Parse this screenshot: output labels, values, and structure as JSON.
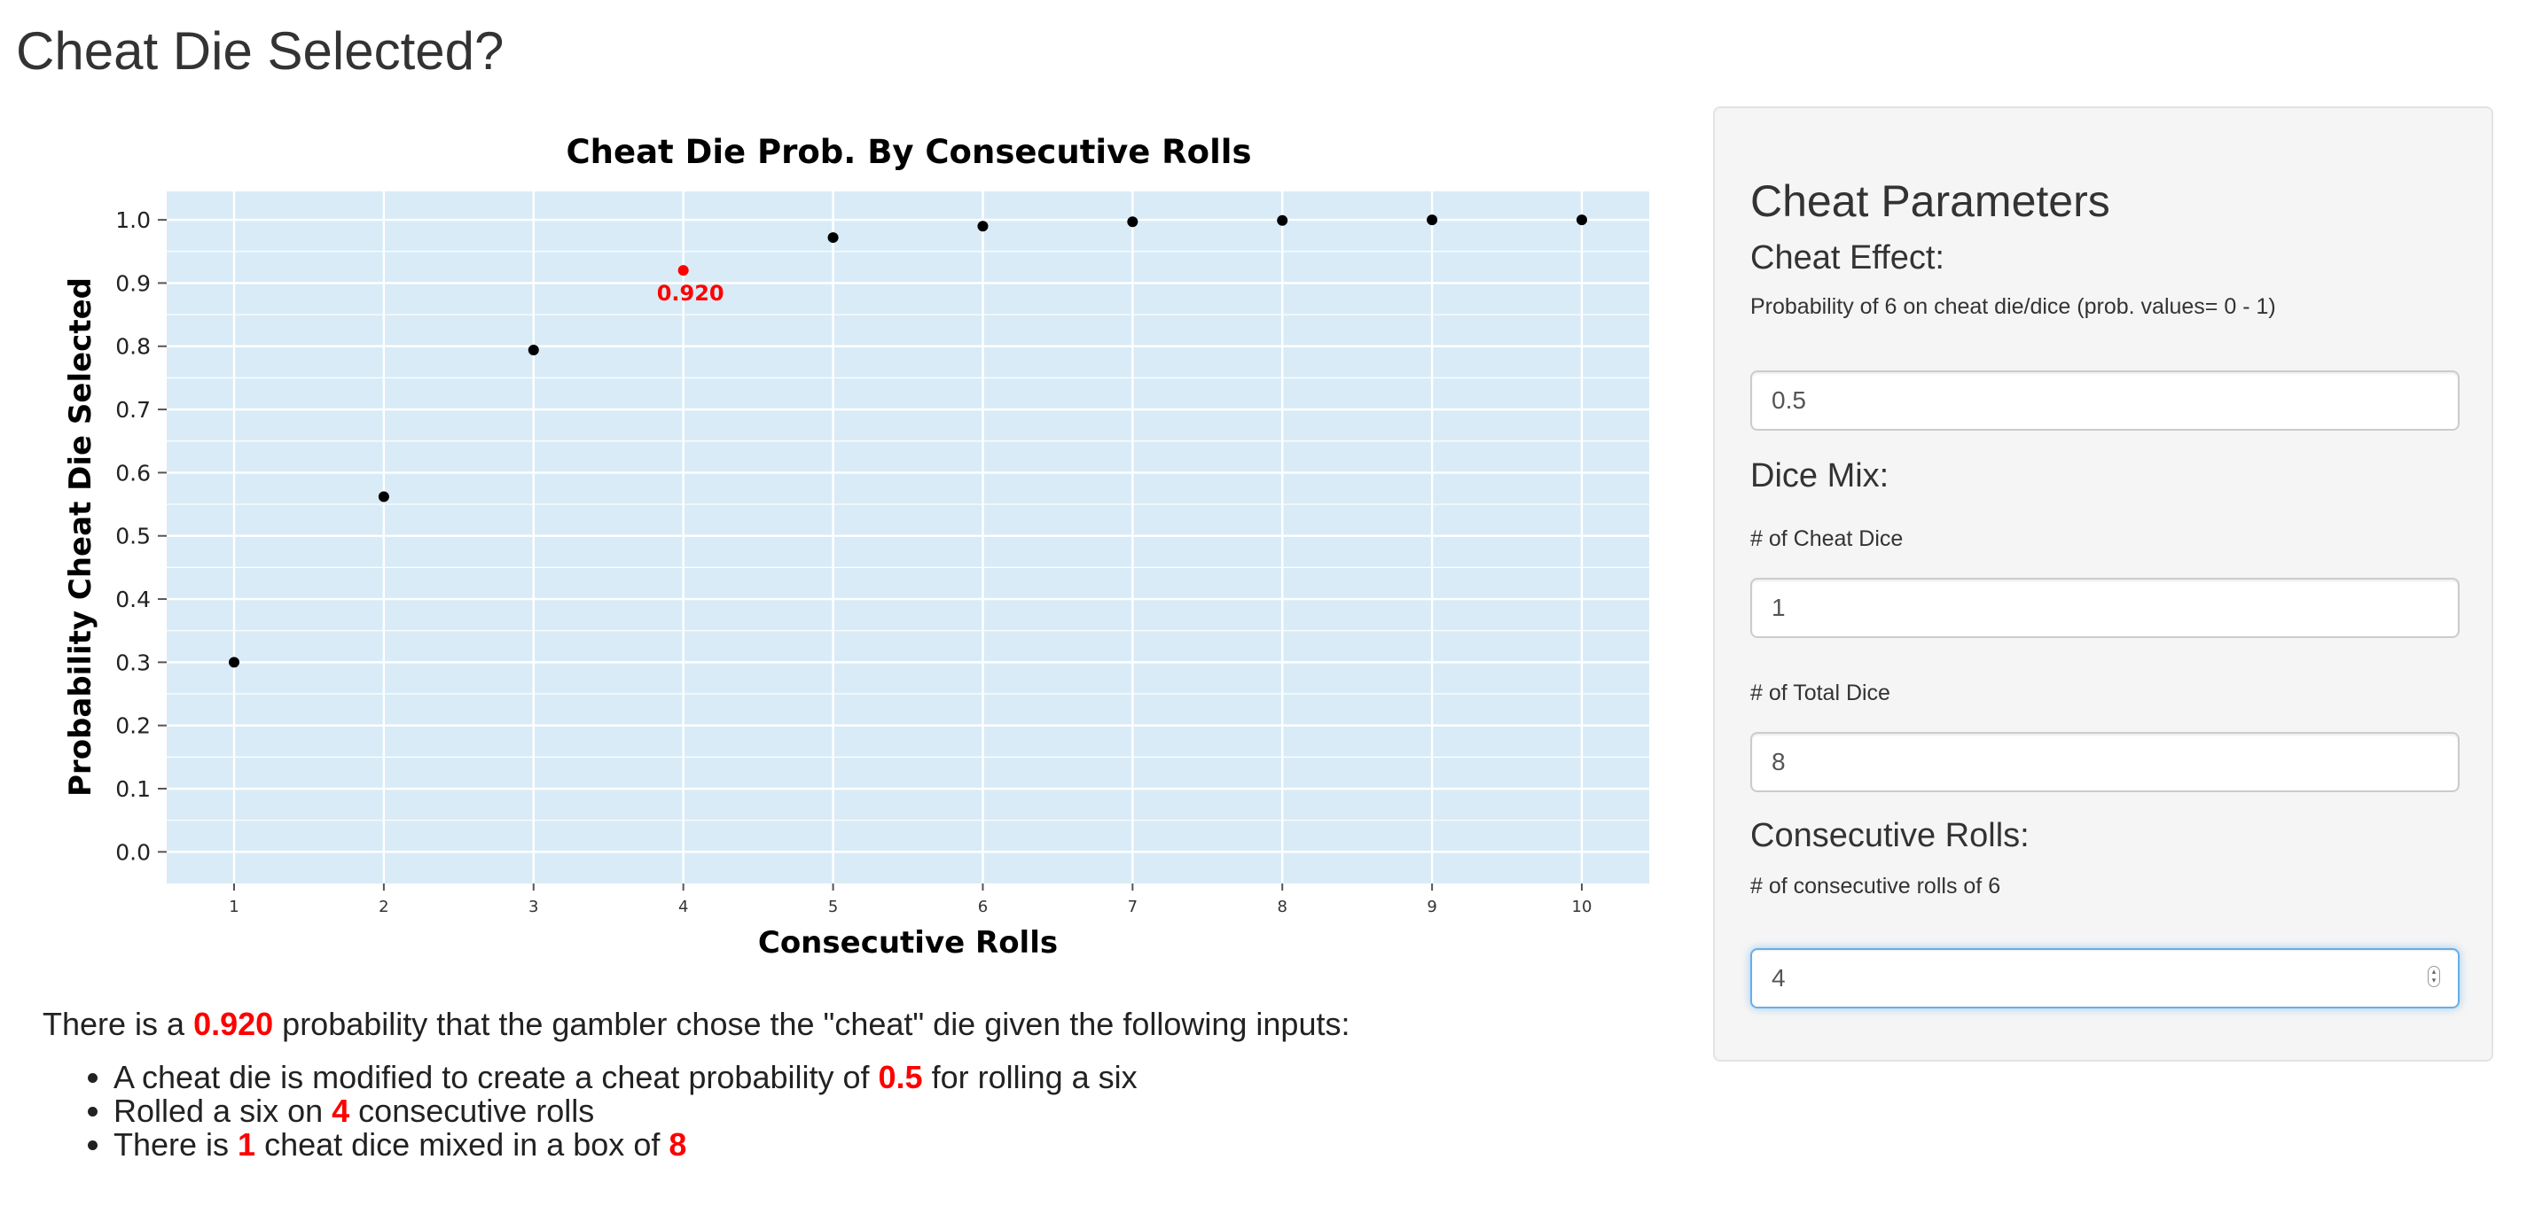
{
  "page": {
    "title": "Cheat Die Selected?"
  },
  "chart_data": {
    "type": "scatter",
    "title": "Cheat Die Prob. By Consecutive Rolls",
    "xlabel": "Consecutive Rolls",
    "ylabel": "Probability Cheat Die Selected",
    "x": [
      1,
      2,
      3,
      4,
      5,
      6,
      7,
      8,
      9,
      10
    ],
    "y": [
      0.3,
      0.562,
      0.794,
      0.92,
      0.972,
      0.99,
      0.997,
      0.999,
      1.0,
      1.0
    ],
    "xlim": [
      0.55,
      10.45
    ],
    "ylim": [
      -0.05,
      1.045
    ],
    "xticks": [
      "1",
      "2",
      "3",
      "4",
      "5",
      "6",
      "7",
      "8",
      "9",
      "10"
    ],
    "yticks": [
      "0.0",
      "0.1",
      "0.2",
      "0.3",
      "0.4",
      "0.5",
      "0.6",
      "0.7",
      "0.8",
      "0.9",
      "1.0"
    ],
    "highlight": {
      "x": 4,
      "y": 0.92,
      "label": "0.920"
    },
    "grid": true,
    "legend": "none",
    "colors": {
      "panel_background": "#d9ebf6",
      "grid": "#ffffff",
      "point": "#000000",
      "highlight": "#ff0000"
    }
  },
  "summary": {
    "intro_prefix": "There is a ",
    "probability": "0.920",
    "intro_suffix": " probability that the gambler chose the \"cheat\" die given the following inputs:",
    "bullet1_prefix": "A cheat die is modified to create a cheat probability of ",
    "cheat_prob": "0.5",
    "bullet1_suffix": " for rolling a six",
    "bullet2_prefix": "Rolled a six on ",
    "rolls": "4",
    "bullet2_suffix": " consecutive rolls",
    "bullet3_prefix": "There is ",
    "cheat_dice": "1",
    "bullet3_middle": " cheat dice mixed in a box of ",
    "total_dice": "8",
    "highlight_color": "#ff0000"
  },
  "panel": {
    "title": "Cheat Parameters",
    "cheat_effect_heading": "Cheat Effect:",
    "cheat_prob_label": "Probability of 6 on cheat die/dice (prob. values= 0 - 1)",
    "cheat_prob_value": "0.5",
    "dice_mix_heading": "Dice Mix:",
    "cheat_dice_label": "# of Cheat Dice",
    "cheat_dice_value": "1",
    "total_dice_label": "# of Total Dice",
    "total_dice_value": "8",
    "rolls_heading": "Consecutive Rolls:",
    "rolls_label": "# of consecutive rolls of 6",
    "rolls_value": "4"
  }
}
